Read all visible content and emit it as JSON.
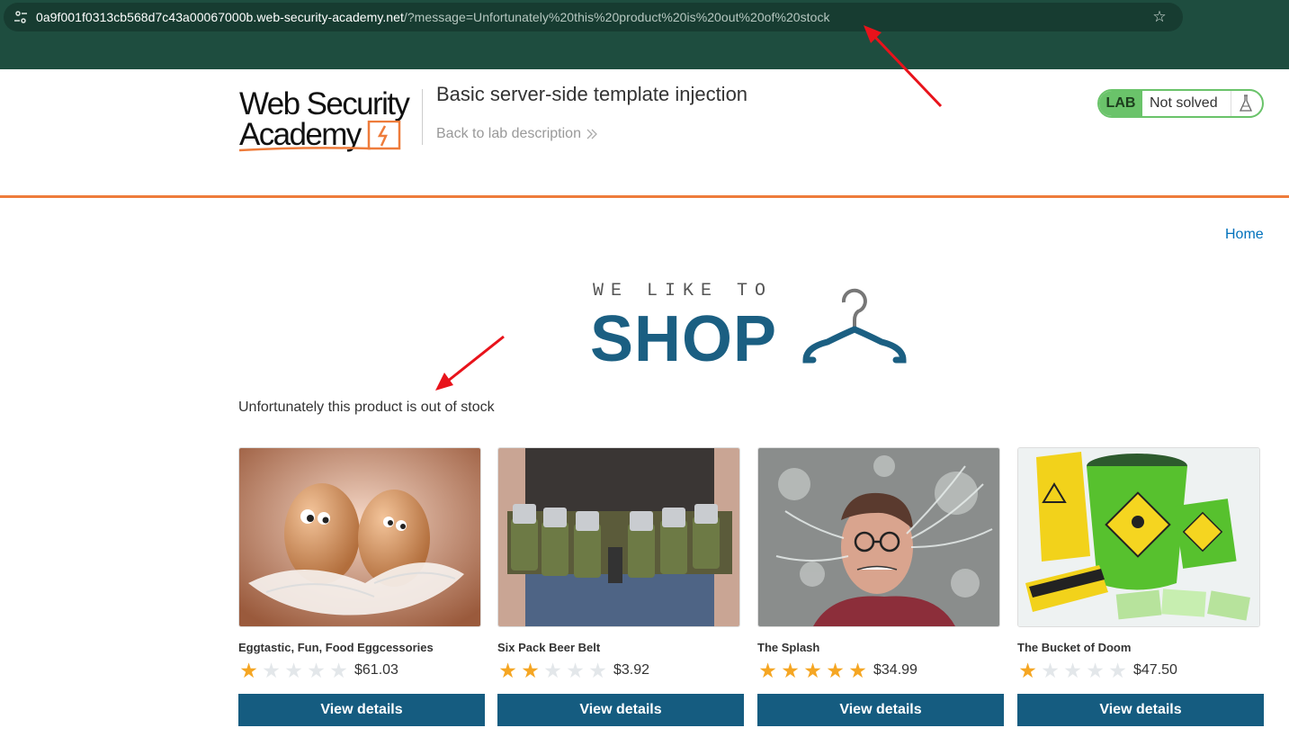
{
  "browser": {
    "url_host": "0a9f001f0313cb568d7c43a00067000b.web-security-academy.net",
    "url_path": "/?message=Unfortunately%20this%20product%20is%20out%20of%20stock",
    "site_info_icon": "tune-icon",
    "bookmark_icon": "star-icon"
  },
  "academy": {
    "logo_line1": "Web Security",
    "logo_line2": "Academy",
    "lab_title": "Basic server-side template injection",
    "back_link": "Back to lab description",
    "lab_badge": "LAB",
    "lab_status": "Not solved"
  },
  "shop": {
    "home_link": "Home",
    "logo_tag": "WE LIKE TO",
    "logo_word": "SHOP",
    "message": "Unfortunately this product is out of stock"
  },
  "products": [
    {
      "name": "Eggtastic, Fun, Food Eggcessories",
      "rating": 1,
      "price": "$61.03",
      "button": "View details"
    },
    {
      "name": "Six Pack Beer Belt",
      "rating": 2,
      "price": "$3.92",
      "button": "View details"
    },
    {
      "name": "The Splash",
      "rating": 5,
      "price": "$34.99",
      "button": "View details"
    },
    {
      "name": "The Bucket of Doom",
      "rating": 1,
      "price": "$47.50",
      "button": "View details"
    }
  ],
  "colors": {
    "accent_orange": "#ee7c3b",
    "button_blue": "#155c80",
    "lab_green": "#6ac36a",
    "star_gold": "#f5a623",
    "annotation_red": "#e8131b"
  }
}
